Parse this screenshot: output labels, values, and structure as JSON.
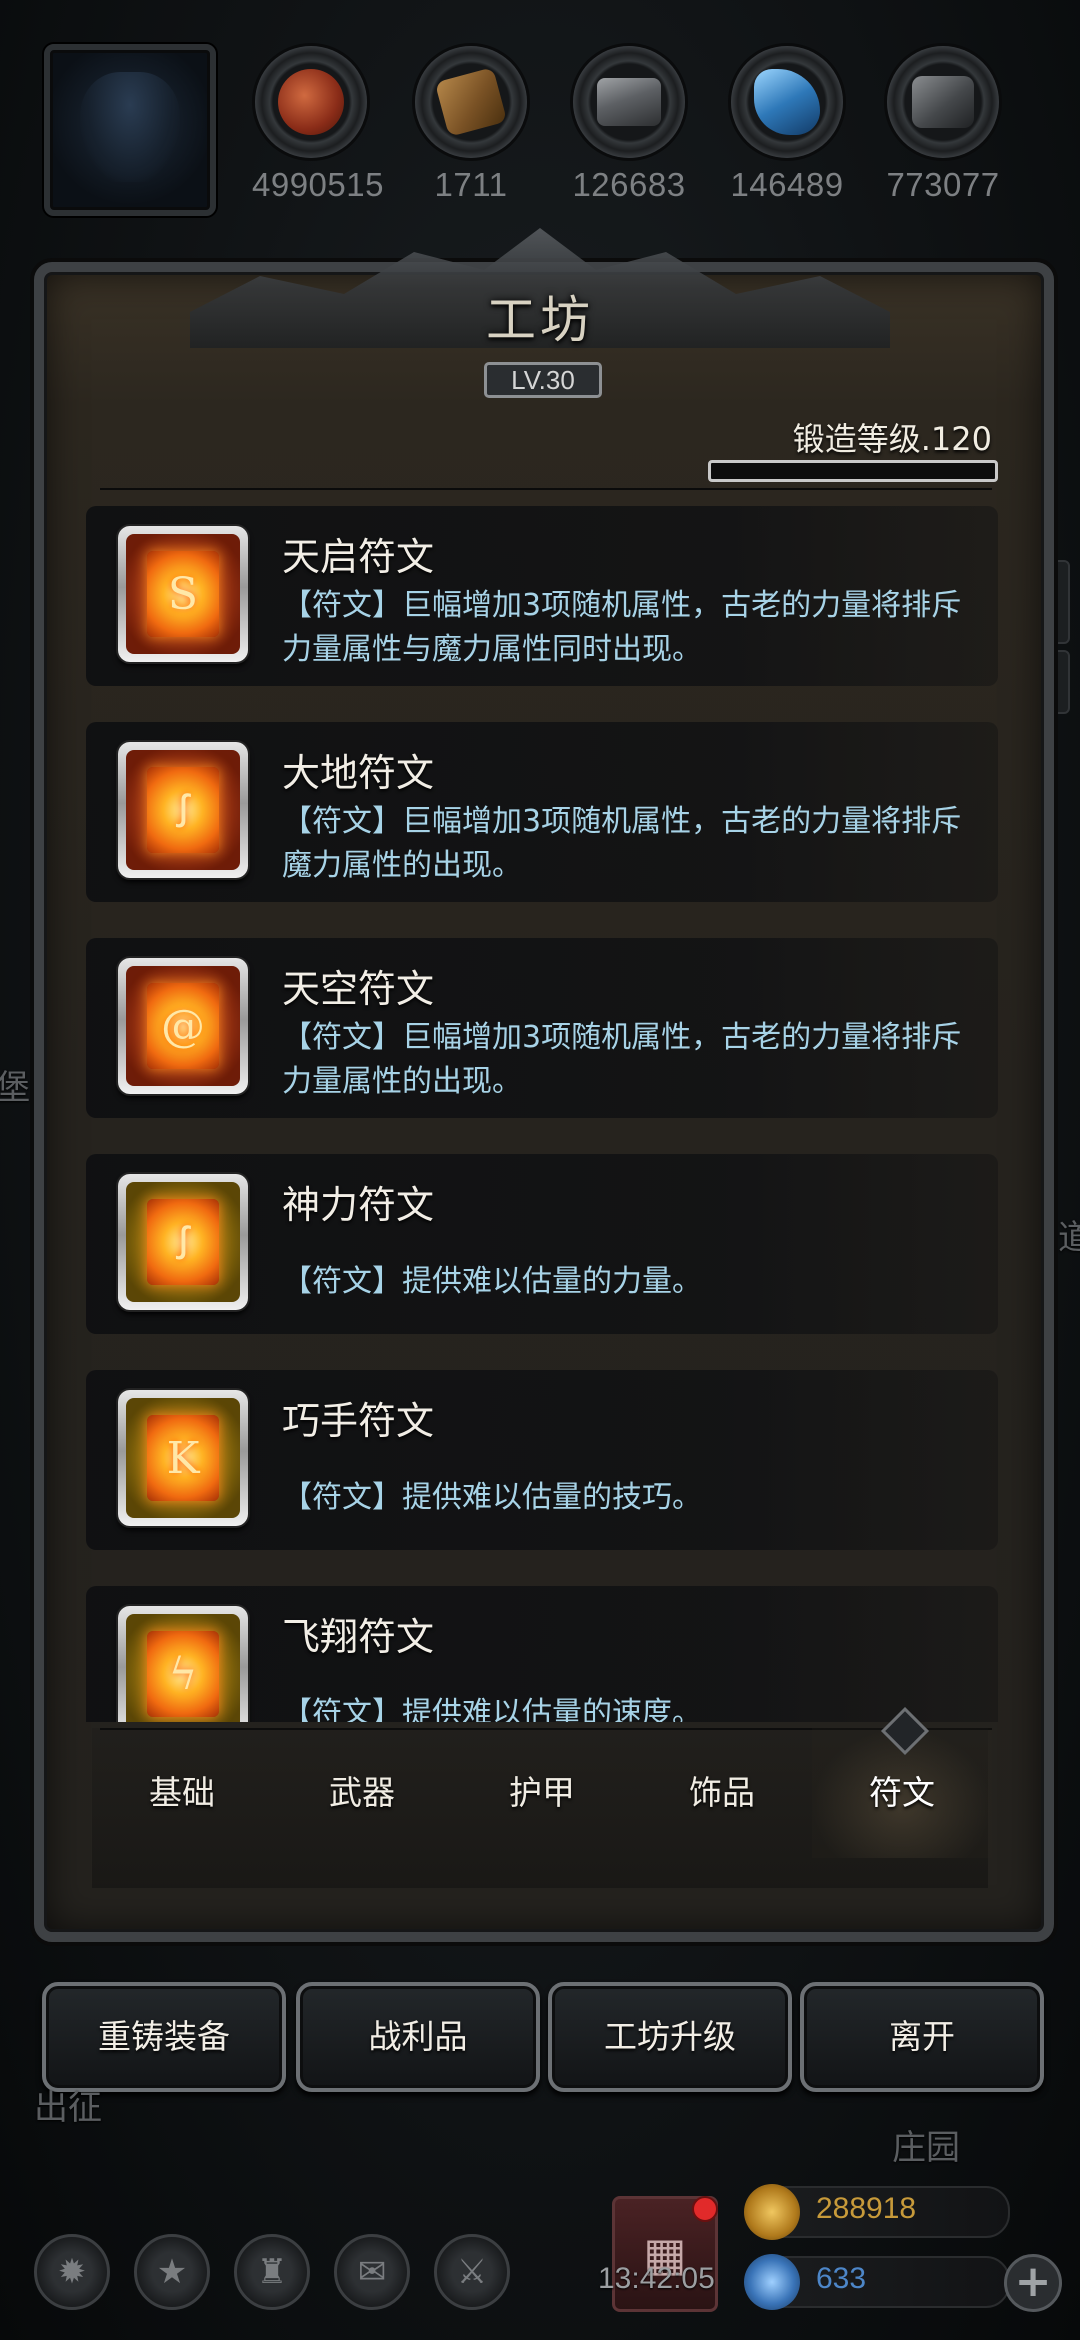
{
  "resources": [
    {
      "value": "4990515",
      "icon": "meat-icon",
      "color": "#a8452a"
    },
    {
      "value": "1711",
      "icon": "wood-icon",
      "color": "#8a6333"
    },
    {
      "value": "126683",
      "icon": "iron-ingot-icon",
      "color": "#6a6d70"
    },
    {
      "value": "146489",
      "icon": "crystal-icon",
      "color": "#2e78b8"
    },
    {
      "value": "773077",
      "icon": "stone-icon",
      "color": "#55585b"
    }
  ],
  "panel": {
    "title": "工坊",
    "level": "LV.30",
    "forge_level_label": "锻造等级.120",
    "forge_progress": 0.0
  },
  "items": [
    {
      "name": "天启符文",
      "desc": "【符文】巨幅增加3项随机属性，古老的力量将排斥力量属性与魔力属性同时出现。",
      "rarity": "red",
      "glyph": "S"
    },
    {
      "name": "大地符文",
      "desc": "【符文】巨幅增加3项随机属性，古老的力量将排斥魔力属性的出现。",
      "rarity": "red",
      "glyph": "ꭍ"
    },
    {
      "name": "天空符文",
      "desc": "【符文】巨幅增加3项随机属性，古老的力量将排斥力量属性的出现。",
      "rarity": "red",
      "glyph": "@"
    },
    {
      "name": "神力符文",
      "desc": "【符文】提供难以估量的力量。",
      "rarity": "gold",
      "glyph": "ꭍ"
    },
    {
      "name": "巧手符文",
      "desc": "【符文】提供难以估量的技巧。",
      "rarity": "gold",
      "glyph": "K"
    },
    {
      "name": "飞翔符文",
      "desc": "【符文】提供难以估量的速度。",
      "rarity": "gold",
      "glyph": "ϟ"
    }
  ],
  "tabs": [
    "基础",
    "武器",
    "护甲",
    "饰品",
    "符文"
  ],
  "active_tab": "符文",
  "actions": [
    "重铸装备",
    "战利品",
    "工坊升级",
    "离开"
  ],
  "background_labels": {
    "left_mid": "堡",
    "bottom_left": "出征",
    "bottom_right": "庄园",
    "right_edge": "道"
  },
  "bottom": {
    "time": "13:42:05",
    "gold": "288918",
    "gems": "633",
    "gold_color": "#c79a3a",
    "gem_color": "#4d86c8"
  }
}
